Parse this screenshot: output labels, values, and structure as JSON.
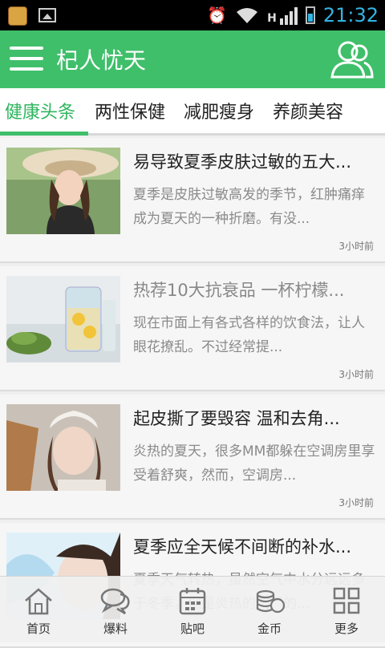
{
  "status_bar": {
    "time": "21:32",
    "network_type": "H",
    "icons": [
      "app-notification-icon",
      "image-notification-icon",
      "alarm-icon",
      "wifi-icon",
      "signal-icon",
      "battery-icon"
    ]
  },
  "app_bar": {
    "title": "杞人忧天",
    "menu_icon": "menu-icon",
    "user_icon": "user-icon",
    "color": "#3fbf6a"
  },
  "tabs": [
    {
      "label": "健康头条",
      "active": true
    },
    {
      "label": "两性保健",
      "active": false
    },
    {
      "label": "减肥瘦身",
      "active": false
    },
    {
      "label": "养颜美容",
      "active": false
    }
  ],
  "articles": [
    {
      "title": "易导致夏季皮肤过敏的五大...",
      "summary": "夏季是皮肤过敏高发的季节，红肿痛痒成为夏天的一种折磨。有没...",
      "time": "3小时前",
      "read": false
    },
    {
      "title": "热荐10大抗衰品 一杯柠檬...",
      "summary": "现在市面上有各式各样的饮食法，让人眼花撩乱。不过经常提...",
      "time": "3小时前",
      "read": true
    },
    {
      "title": "起皮撕了要毁容 温和去角...",
      "summary": "炎热的夏天，很多MM都躲在空调房里享受着舒爽，然而，空调房...",
      "time": "3小时前",
      "read": false
    },
    {
      "title": "夏季应全天候不间断的补水...",
      "summary": "夏季天气转热，虽然空气中水分远远多于冬季，但是炎热的气温的...",
      "time": "",
      "read": false
    }
  ],
  "bottom_nav": [
    {
      "label": "首页",
      "icon": "home-icon"
    },
    {
      "label": "爆料",
      "icon": "chat-bubbles-icon"
    },
    {
      "label": "贴吧",
      "icon": "calendar-icon"
    },
    {
      "label": "金币",
      "icon": "coins-icon"
    },
    {
      "label": "更多",
      "icon": "grid-icon"
    }
  ]
}
